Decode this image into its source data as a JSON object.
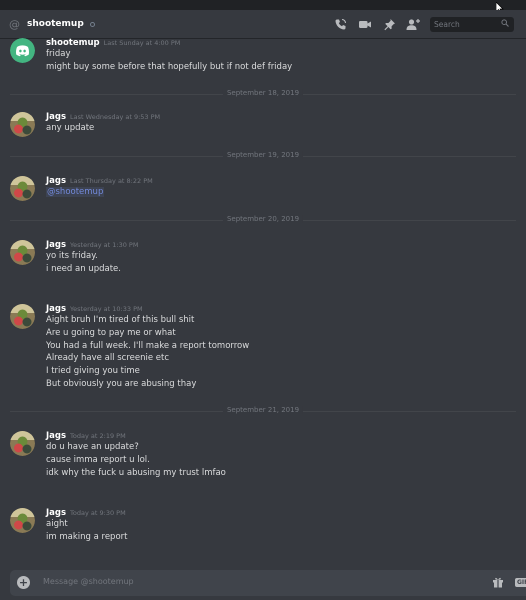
{
  "header": {
    "at_symbol": "@",
    "channel_name": "shootemup",
    "search_placeholder": "Search"
  },
  "messages": [
    {
      "author": "shootemup",
      "timestamp": "Last Sunday at 4:00 PM",
      "avatar": "discord-logo",
      "lines": [
        "friday",
        "might buy some before that hopefully but if not def friday"
      ]
    },
    {
      "author": "Jags",
      "timestamp": "Last Wednesday at 9:53 PM",
      "avatar": "user-avatar",
      "lines": [
        "any update"
      ]
    },
    {
      "author": "Jags",
      "timestamp": "Last Thursday at 8:22 PM",
      "avatar": "user-avatar",
      "lines": [
        "@shootemup"
      ]
    },
    {
      "author": "Jags",
      "timestamp": "Yesterday at 1:30 PM",
      "avatar": "user-avatar",
      "lines": [
        "yo its friday.",
        "i need an update."
      ]
    },
    {
      "author": "Jags",
      "timestamp": "Yesterday at 10:33 PM",
      "avatar": "user-avatar",
      "lines": [
        "Aight bruh I'm tired of this bull shit",
        "Are u going to pay me or what",
        "You had a full week. I'll make a report tomorrow",
        "Already have all screenie etc",
        "I tried giving you time",
        "But obviously you are abusing thay"
      ]
    },
    {
      "author": "Jags",
      "timestamp": "Today at 2:19 PM",
      "avatar": "user-avatar",
      "lines": [
        "do u have an update?",
        "cause imma report u lol.",
        "idk why the fuck u abusing my trust lmfao"
      ]
    },
    {
      "author": "Jags",
      "timestamp": "Today at 9:30 PM",
      "avatar": "user-avatar",
      "lines": [
        "aight",
        "im making a report"
      ]
    }
  ],
  "dividers": [
    "September 18, 2019",
    "September 19, 2019",
    "September 20, 2019",
    "September 21, 2019"
  ],
  "composer": {
    "add_label": "+",
    "placeholder": "Message @shootemup",
    "gif_label": "GIF"
  },
  "colors": {
    "background": "#36393f",
    "mention": "#7289da",
    "discord_logo_bg": "#43b581"
  }
}
